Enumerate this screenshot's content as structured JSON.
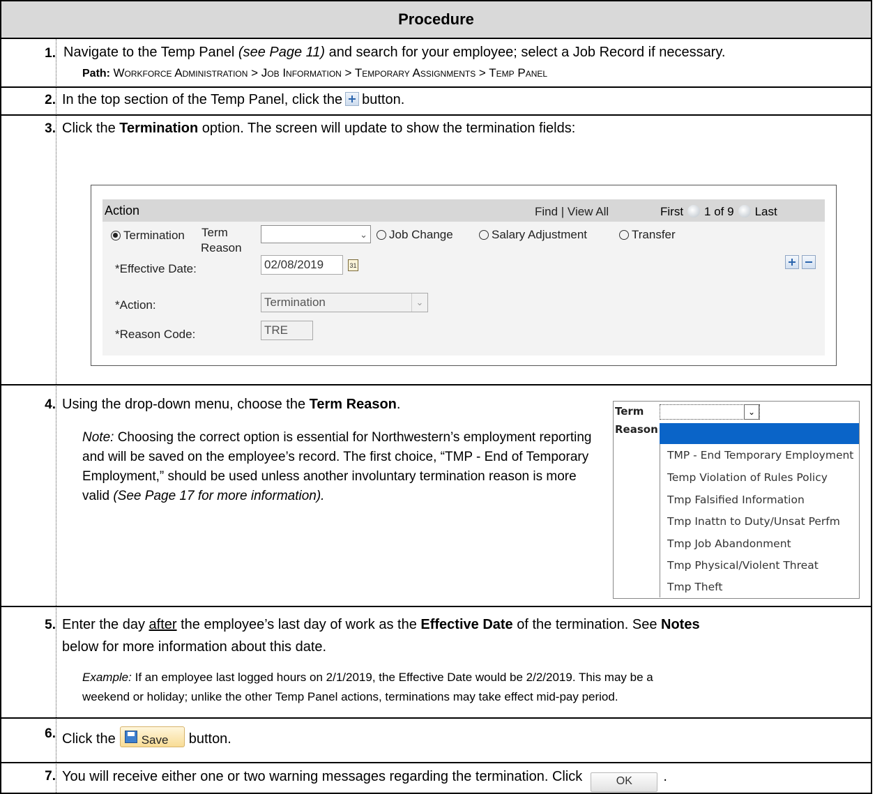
{
  "header": {
    "title": "Procedure"
  },
  "steps": {
    "s1": {
      "num": "1.",
      "a": "Navigate to the Temp Panel ",
      "ref": "(see Page 11)",
      "b": " and search for your employee; select a Job Record if necessary.",
      "path_label": "Path:",
      "path": "Workforce Administration > Job Information > Temporary Assignments > Temp Panel"
    },
    "s2": {
      "num": "2.",
      "a": "In the top section of the Temp Panel, click the",
      "b": "button."
    },
    "s3": {
      "num": "3.",
      "a": "Click the ",
      "bold": "Termination",
      "b": " option. The screen will update to show the termination fields:"
    },
    "s4": {
      "num": "4.",
      "a": "Using the drop-down menu, choose the ",
      "bold": "Term Reason",
      "b": ".",
      "note_label": "Note:",
      "note_text": " Choosing the correct option is essential for Northwestern’s employment reporting and will be saved on the employee’s record. The first choice, “TMP - End of Temporary Employment,” should be used unless another involuntary termination reason is more valid ",
      "note_ref": "(See Page 17 for more information)."
    },
    "s5": {
      "num": "5.",
      "a": "Enter the day ",
      "u": "after",
      "b": " the employee’s last day of work as the ",
      "bold1": "Effective Date",
      "c": " of the termination. See ",
      "bold2": "Notes",
      "line2": "below for more information about this date.",
      "ex_label": "Example:",
      "ex1": " If an employee last logged hours on 2/1/2019, the Effective Date would be 2/2/2019. This may be a",
      "ex2": "weekend or holiday; unlike the other Temp Panel actions, terminations may take effect mid-pay period."
    },
    "s6": {
      "num": "6.",
      "a": "Click the",
      "b": "button."
    },
    "s7": {
      "num": "7.",
      "a": "You will receive either one or two warning messages regarding the termination. Click",
      "b": "."
    }
  },
  "panel": {
    "title": "Action",
    "find_view": "Find | View All",
    "first": "First",
    "count": "1 of 9",
    "last": "Last",
    "radio_termination": "Termination",
    "term_label_1": "Term",
    "term_label_2": "Reason",
    "radio_job_change": "Job Change",
    "radio_salary": "Salary Adjustment",
    "radio_transfer": "Transfer",
    "effective_date_label": "*Effective Date:",
    "effective_date_value": "02/08/2019",
    "action_label": "*Action:",
    "action_value": "Termination",
    "reason_code_label": "*Reason Code:",
    "reason_code_value": "TRE",
    "calendar_glyph": "31"
  },
  "dropdown": {
    "label_1": "Term",
    "label_2": "Reason",
    "options": [
      "TMP - End Temporary Employment",
      "Temp Violation of Rules Policy",
      "Tmp Falsified Information",
      "Tmp Inattn to Duty/Unsat Perfm",
      "Tmp Job Abandonment",
      "Tmp Physical/Violent Threat",
      "Tmp Theft"
    ]
  },
  "buttons": {
    "save": "Save",
    "ok": "OK"
  },
  "colors": {
    "header_bg": "#d9d9d9",
    "highlight": "#0a64c8",
    "save_bg": "#f8dc95"
  }
}
